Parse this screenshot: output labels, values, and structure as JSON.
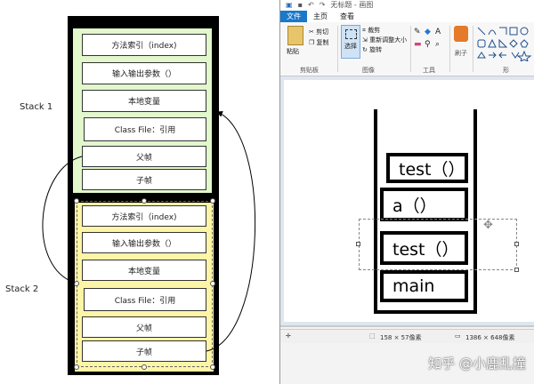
{
  "diagram": {
    "stack1_label": "Stack 1",
    "stack2_label": "Stack 2",
    "stack1_frames": [
      "方法索引（index)",
      "输入输出参数（）",
      "本地变量",
      "Class File：引用",
      "父帧",
      "子帧"
    ],
    "stack2_frames": [
      "方法索引（index)",
      "输入输出参数（）",
      "本地变量",
      "Class File：引用",
      "父帧",
      "子帧"
    ],
    "colors": {
      "stack1_fill": "#e2f7cc",
      "stack2_fill": "#fdf5a6",
      "border": "#000000"
    }
  },
  "paint": {
    "title_text": "无标题 - 画图",
    "tabs": [
      "文件",
      "主页",
      "查看"
    ],
    "active_tab": "文件",
    "clipboard": {
      "paste": "粘贴",
      "cut": "剪切",
      "copy": "复制",
      "label": "剪贴板"
    },
    "image": {
      "select": "选择",
      "crop": "裁剪",
      "resize": "重新调整大小",
      "rotate": "旋转",
      "label": "图像"
    },
    "tools": {
      "label": "工具"
    },
    "brushes": {
      "label": "刷子"
    },
    "shapes": {
      "label": "形"
    },
    "canvas_frames": [
      "test（）",
      "a（）",
      "test（）",
      "main"
    ],
    "status": {
      "selection_size": "158 × 57像素",
      "canvas_size": "1386 × 648像素"
    },
    "watermark": "知乎 @小鹿乱撞",
    "colors": {
      "accent": "#1979ca"
    }
  }
}
